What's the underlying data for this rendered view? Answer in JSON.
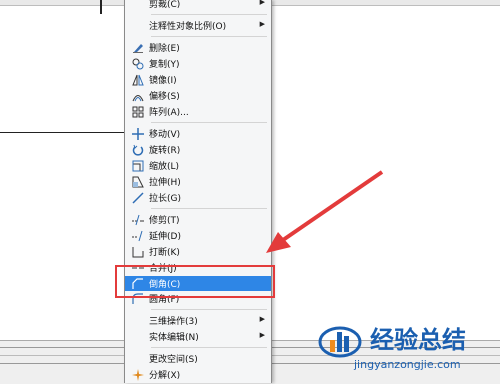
{
  "menu": {
    "items": [
      {
        "label": "剪裁(C)",
        "submenu": true
      },
      {
        "label": "注释性对象比例(O)",
        "submenu": true
      },
      {
        "label": "删除(E)"
      },
      {
        "label": "复制(Y)"
      },
      {
        "label": "镜像(I)"
      },
      {
        "label": "偏移(S)"
      },
      {
        "label": "阵列(A)..."
      },
      {
        "label": "移动(V)"
      },
      {
        "label": "旋转(R)"
      },
      {
        "label": "缩放(L)"
      },
      {
        "label": "拉伸(H)"
      },
      {
        "label": "拉长(G)"
      },
      {
        "label": "修剪(T)"
      },
      {
        "label": "延伸(D)"
      },
      {
        "label": "打断(K)"
      },
      {
        "label": "合并(J)"
      },
      {
        "label": "倒角(C)"
      },
      {
        "label": "圆角(F)"
      },
      {
        "label": "三维操作(3)",
        "submenu": true
      },
      {
        "label": "实体编辑(N)",
        "submenu": true
      },
      {
        "label": "更改空间(S)"
      },
      {
        "label": "分解(X)"
      }
    ],
    "selected": "倒角(C)"
  },
  "annotation_color": "#e33b3b",
  "selection_color": "#2e86e6",
  "watermark": {
    "title": "经验总结",
    "url": "jingyanzongjie.com"
  }
}
